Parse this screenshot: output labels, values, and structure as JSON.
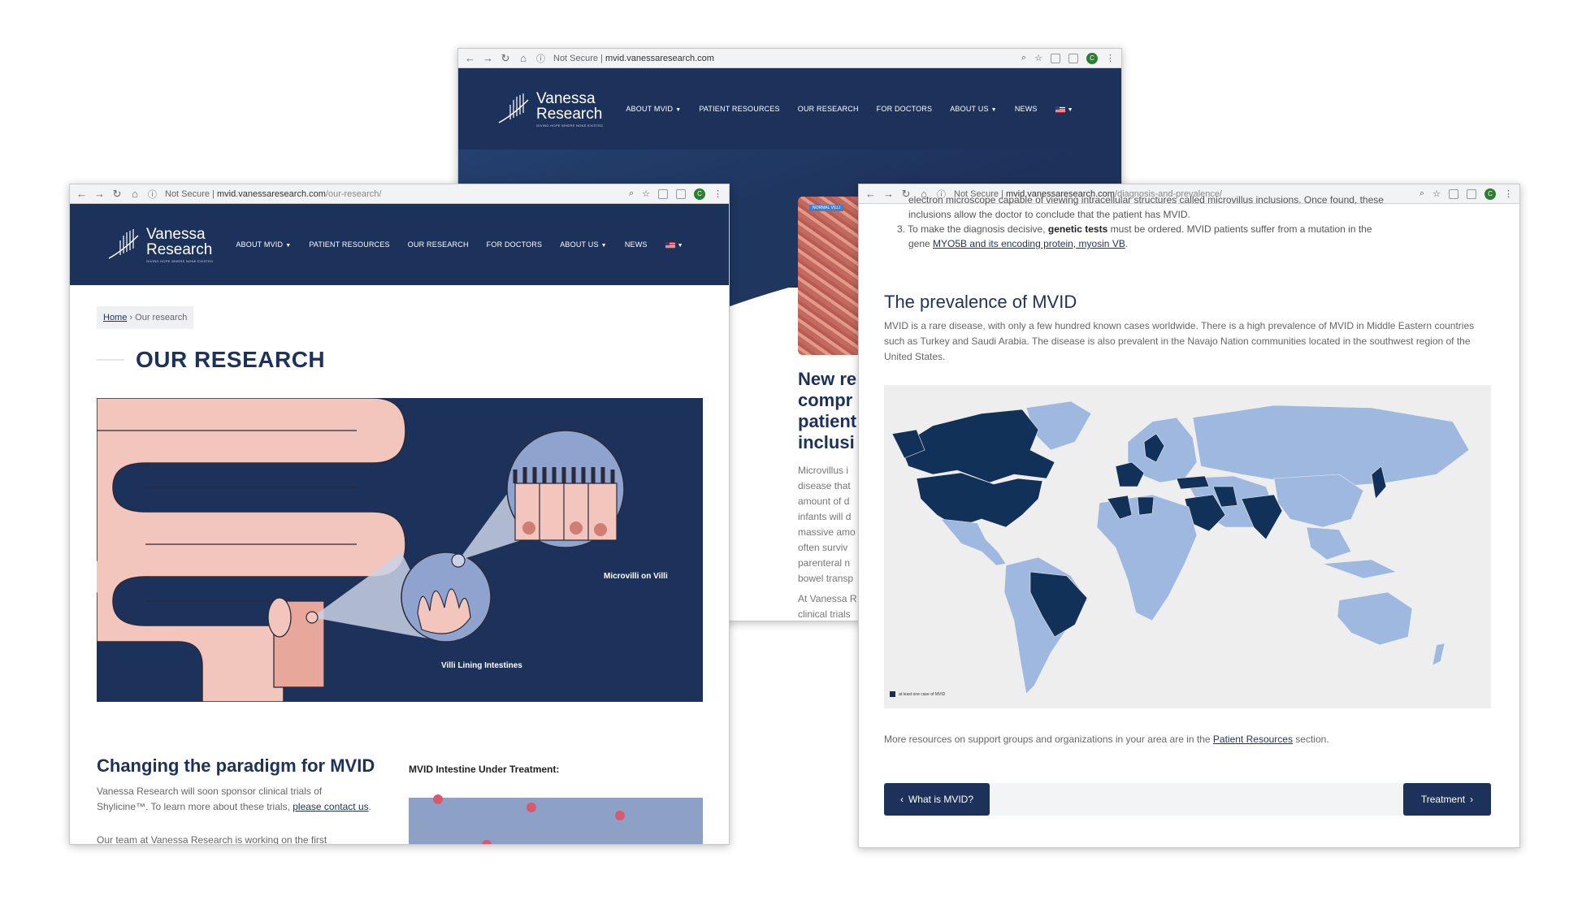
{
  "colors": {
    "navy": "#1d325b",
    "map_highlight": "#123158",
    "map_base": "#9fb8e0"
  },
  "back_window": {
    "browser": {
      "security": "Not Secure",
      "domain": "mvid.vanessaresearch.com",
      "path": ""
    },
    "logo": {
      "name_line1": "Vanessa",
      "name_line2": "Research",
      "tagline": "GIVING HOPE WHERE NONE EXISTED"
    },
    "nav": [
      "ABOUT MVID",
      "PATIENT RESOURCES",
      "OUR RESEARCH",
      "FOR DOCTORS",
      "ABOUT US",
      "NEWS"
    ],
    "image_tag": "NORMAL VILLI",
    "title_lines": [
      "New re",
      "compr",
      "patient",
      "inclusi"
    ],
    "body_lines": [
      "Microvillus i",
      "disease that",
      "amount of d",
      "infants will d",
      "massive amo",
      "often surviv",
      "parenteral n",
      "bowel transp"
    ],
    "body2": "At Vanessa R",
    "body3": "clinical trials"
  },
  "left_window": {
    "browser": {
      "security": "Not Secure",
      "domain": "mvid.vanessaresearch.com",
      "path": "/our-research/"
    },
    "logo": {
      "name_line1": "Vanessa",
      "name_line2": "Research",
      "tagline": "GIVING HOPE WHERE NONE EXISTED"
    },
    "nav": [
      "ABOUT MVID",
      "PATIENT RESOURCES",
      "OUR RESEARCH",
      "FOR DOCTORS",
      "ABOUT US",
      "NEWS"
    ],
    "breadcrumb": {
      "home": "Home",
      "separator": "›",
      "current": "Our research"
    },
    "page_title": "OUR RESEARCH",
    "illustration": {
      "label_microvilli": "Microvilli on Villi",
      "label_villi": "Villi Lining Intestines"
    },
    "section_title": "Changing the paradigm for MVID",
    "section_body_1": "Vanessa Research will soon sponsor clinical trials of Shylicine™. To learn more about these trials, ",
    "section_link": "please contact us",
    "section_body_end": ".",
    "section_body_2": "Our team at Vanessa Research is working on the first",
    "side_label": "MVID Intestine Under Treatment:"
  },
  "right_window": {
    "browser": {
      "security": "Not Secure",
      "domain": "mvid.vanessaresearch.com",
      "path": "/diagnosis-and-prevalence/"
    },
    "list_top_1": "electron microscope capable of viewing intracellular structures called microvillus inclusions. Once found, these",
    "list_top_2": "inclusions allow the doctor to conclude that the patient has MVID.",
    "item3_prefix": "3. To make the diagnosis decisive, ",
    "item3_bold": "genetic tests",
    "item3_suffix": " must be ordered. MVID patients suffer from a mutation in the",
    "item3_line2_prefix": "gene ",
    "item3_link": "MYO5B and its encoding protein, myosin VB",
    "item3_line2_suffix": ".",
    "heading": "The prevalence of MVID",
    "body": "MVID is a rare disease, with only a few hundred known cases worldwide. There is a high prevalence of MVID in Middle Eastern countries such as Turkey and Saudi Arabia. The disease is also prevalent in the Navajo Nation communities located in the southwest region of the United States.",
    "map_legend": "at least one case of MVID",
    "more_prefix": "More resources on support groups and organizations in your area are in the ",
    "more_link": "Patient Resources",
    "more_suffix": " section.",
    "prev_button": "What is MVID?",
    "next_button": "Treatment"
  }
}
